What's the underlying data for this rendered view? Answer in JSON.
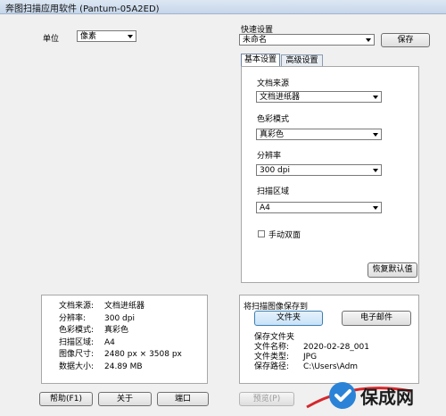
{
  "window": {
    "title": "奔图扫描应用软件 (Pantum-05A2ED)"
  },
  "unit": {
    "label": "单位",
    "value": "像素"
  },
  "quick_settings": {
    "label": "快速设置",
    "value": "未命名",
    "save_label": "保存"
  },
  "tabs": [
    {
      "label": "基本设置",
      "active": true
    },
    {
      "label": "高级设置",
      "active": false
    }
  ],
  "basic": {
    "source_label": "文档来源",
    "source_value": "文档进纸器",
    "color_label": "色彩模式",
    "color_value": "真彩色",
    "resolution_label": "分辨率",
    "resolution_value": "300 dpi",
    "area_label": "扫描区域",
    "area_value": "A4",
    "duplex_label": "手动双面",
    "restore_defaults_label": "恢复默认值"
  },
  "summary": {
    "rows": [
      {
        "key": "文档来源:",
        "value": "文档进纸器"
      },
      {
        "key": "分辨率:",
        "value": "300 dpi"
      },
      {
        "key": "色彩模式:",
        "value": "真彩色"
      },
      {
        "key": "扫描区域:",
        "value": "A4"
      },
      {
        "key": "图像尺寸:",
        "value": "2480 px × 3508 px"
      },
      {
        "key": "数据大小:",
        "value": "24.89 MB"
      }
    ]
  },
  "save_panel": {
    "title": "将扫描图像保存到",
    "folder_label": "文件夹",
    "email_label": "电子邮件",
    "save_as_label": "保存文件夹",
    "filename_key": "文件名称:",
    "filename_value": "2020-02-28_001",
    "filetype_key": "文件类型:",
    "filetype_value": "JPG",
    "path_key": "保存路径:",
    "path_value": "C:\\Users\\Adm"
  },
  "buttons": {
    "help": "帮助(F1)",
    "about": "关于",
    "port": "端口",
    "preview": "预览(P)"
  },
  "watermark": {
    "text": "保成网",
    "color": "#2a83d6",
    "ring_color": "#d6272b"
  }
}
